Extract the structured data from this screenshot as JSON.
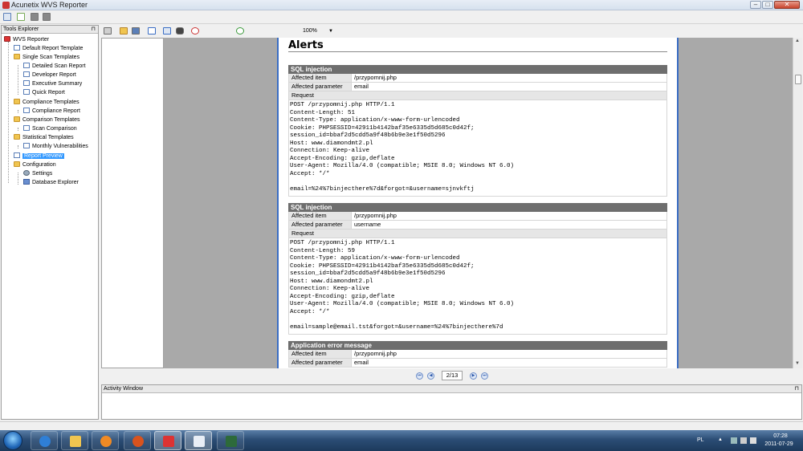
{
  "window": {
    "title": "Acunetix WVS Reporter",
    "minimize": "–",
    "maximize": "□",
    "close": "✕"
  },
  "tools_explorer": {
    "title": "Tools Explorer",
    "pin": "⊓",
    "items": [
      {
        "label": "WVS Reporter"
      },
      {
        "label": "Default Report Template"
      },
      {
        "label": "Single Scan Templates"
      },
      {
        "label": "Detailed Scan Report"
      },
      {
        "label": "Developer Report"
      },
      {
        "label": "Executive Summary"
      },
      {
        "label": "Quick Report"
      },
      {
        "label": "Compliance Templates"
      },
      {
        "label": "Compliance Report"
      },
      {
        "label": "Comparison Templates"
      },
      {
        "label": "Scan Comparison"
      },
      {
        "label": "Statistical Templates"
      },
      {
        "label": "Monthly Vulnerabilities"
      },
      {
        "label": "Report Preview"
      },
      {
        "label": "Configuration"
      },
      {
        "label": "Settings"
      },
      {
        "label": "Database Explorer"
      }
    ]
  },
  "preview_toolbar": {
    "zoom": "100%"
  },
  "report": {
    "heading": "Alerts",
    "alerts": [
      {
        "title": "SQL injection",
        "item_key": "Affected item",
        "item_value": "/przypomnij.php",
        "param_key": "Affected parameter",
        "param_value": "email",
        "request_label": "Request",
        "request": "POST /przypomnij.php HTTP/1.1\nContent-Length: 51\nContent-Type: application/x-www-form-urlencoded\nCookie: PHPSESSID=42911b4142baf35e6335d5d685c0d42f;\nsession_id=bbaf2d5cdd5a9f48b6b9e3e1f50d5296\nHost: www.diamondmt2.pl\nConnection: Keep-alive\nAccept-Encoding: gzip,deflate\nUser-Agent: Mozilla/4.0 (compatible; MSIE 8.0; Windows NT 6.0)\nAccept: */*\n\nemail=%24%7binjecthere%7d&forgot=&username=sjnvkftj"
      },
      {
        "title": "SQL injection",
        "item_key": "Affected item",
        "item_value": "/przypomnij.php",
        "param_key": "Affected parameter",
        "param_value": "username",
        "request_label": "Request",
        "request": "POST /przypomnij.php HTTP/1.1\nContent-Length: 59\nContent-Type: application/x-www-form-urlencoded\nCookie: PHPSESSID=42911b4142baf35e6335d5d685c0d42f;\nsession_id=bbaf2d5cdd5a9f48b6b9e3e1f50d5296\nHost: www.diamondmt2.pl\nConnection: Keep-alive\nAccept-Encoding: gzip,deflate\nUser-Agent: Mozilla/4.0 (compatible; MSIE 8.0; Windows NT 6.0)\nAccept: */*\n\nemail=sample@email.tst&forgot=&username=%24%7binjecthere%7d"
      },
      {
        "title": "Application error message",
        "item_key": "Affected item",
        "item_value": "/przypomnij.php",
        "param_key": "Affected parameter",
        "param_value": "email"
      }
    ]
  },
  "page_nav": {
    "page": "2/13",
    "first": "⏮",
    "prev": "◀",
    "next": "▶",
    "last": "⏭"
  },
  "activity_window": {
    "title": "Activity Window",
    "pin": "⊓"
  },
  "taskbar": {
    "language": "PL",
    "time": "07:28",
    "date": "2011-07-29"
  },
  "colors": {
    "selection": "#3399ff",
    "alert_header": "#6e6e6e",
    "page_border": "#3a6dc4",
    "preview_bg": "#a9a9a9"
  },
  "icons": [
    "search-icon",
    "print-icon",
    "open-folder-icon",
    "save-icon",
    "export-icon",
    "page-view-icon",
    "binoculars-icon",
    "zoom-in-icon",
    "zoom-out-icon"
  ]
}
